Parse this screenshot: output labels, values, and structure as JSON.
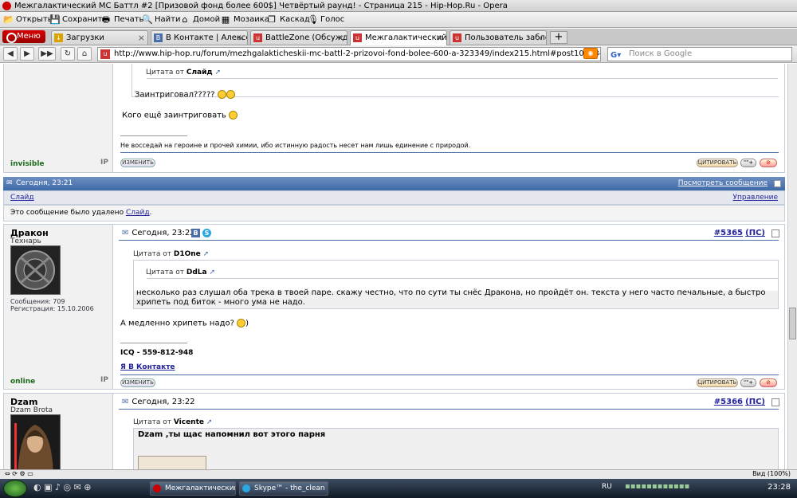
{
  "window": {
    "title": "Межгалактический MC Баттл #2 [Призовой фонд более 600$] Четвёртый раунд! - Страница 215 - Hip-Hop.Ru - Opera"
  },
  "toolbar": {
    "open": "Открыть",
    "save": "Сохранить",
    "print": "Печать",
    "find": "Найти",
    "home": "Домой",
    "mosaic": "Мозаика",
    "cascade": "Каскад",
    "voice": "Голос"
  },
  "menu": {
    "label": "Меню"
  },
  "tabs": [
    {
      "label": "Загрузки"
    },
    {
      "label": "В Контакте | Алексей \"..."
    },
    {
      "label": "BattleZone (Обсужден..."
    },
    {
      "label": "Межгалактический M..."
    },
    {
      "label": "Пользователь заблок..."
    }
  ],
  "address": {
    "url": "http://www.hip-hop.ru/forum/mezhgalakticheskii-mc-battl-2-prizovoi-fond-bolee-600-a-323349/index215.html#post1071344858",
    "search_placeholder": "Поиск в Google"
  },
  "post1": {
    "quote_label": "Цитата от",
    "quote_author": "Слайд",
    "quote_text": "Заинтриговал?????",
    "text": "Кого ещё заинтриговать",
    "signature": "Не восседай на героине и прочей химии, ибо истинную радость несет нам лишь единение с природой.",
    "status": "invisible",
    "ip": "IP",
    "edit": "ИЗМЕНИТЬ",
    "quote_btn": "ЦИТИРОВАТЬ"
  },
  "deleted": {
    "date": "Сегодня, 23:21",
    "view_link": "Посмотреть сообщение",
    "author": "Слайд",
    "manage": "Управление",
    "notice_prefix": "Это сообщение было удалено",
    "notice_author": "Слайд"
  },
  "post2": {
    "date": "Сегодня, 23:22",
    "vk": "В",
    "num": "#5365",
    "ps": "(ПС)",
    "username": "Дракон",
    "usertitle": "Технарь",
    "messages": "Сообщения: 709",
    "registered": "Регистрация: 15.10.2006",
    "quote1_label": "Цитата от",
    "quote1_author": "D1One",
    "quote2_label": "Цитата от",
    "quote2_author": "DdLa",
    "quote2_text": "несколько раз слушал оба трека в твоей паре. скажу честно, что по сути ты снёс Дракона, но пройдёт он. текста у него часто печальные, а быстро хрипеть под биток - много ума не надо.",
    "text": "А медленно хрипеть надо?",
    "text_end": ")",
    "sig_icq": "ICQ - 559-812-948",
    "sig_vk": "Я В Контакте",
    "status": "online",
    "ip": "IP",
    "edit": "ИЗМЕНИТЬ",
    "quote_btn": "ЦИТИРОВАТЬ"
  },
  "post3": {
    "date": "Сегодня, 23:22",
    "num": "#5366",
    "ps": "(ПС)",
    "username": "Dzam",
    "usertitle": "Dzam Brota",
    "quote_label": "Цитата от",
    "quote_author": "Vicente",
    "quote_text": "Dzam ,ты щас напомнил вот этого парня"
  },
  "statusbar": {
    "zoom": "Вид (100%)"
  },
  "taskbar": {
    "items": [
      {
        "label": "Межгалактический..."
      },
      {
        "label": "Skype™ - the_clean"
      }
    ],
    "lang": "RU",
    "clock": "23:28"
  },
  "colors": {
    "accent": "#3f6aa8",
    "link": "#22229c",
    "online": "#1b6b1b"
  }
}
